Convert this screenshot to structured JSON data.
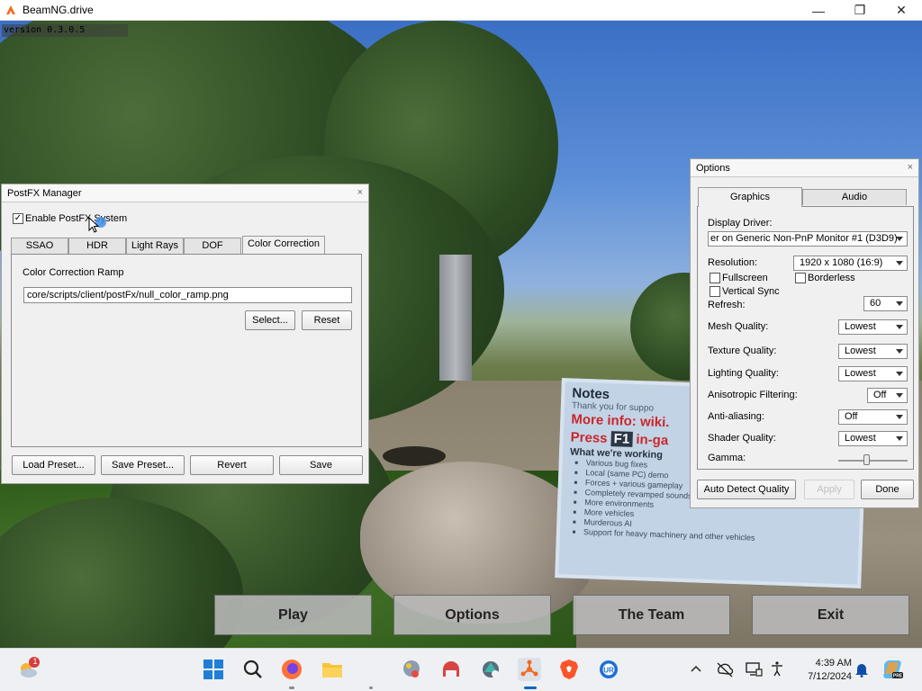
{
  "window": {
    "title": "BeamNG.drive",
    "version": "version 0.3.0.5",
    "controls": {
      "minimize": "—",
      "maximize": "❐",
      "close": "✕"
    }
  },
  "notes_sign": {
    "title": "Notes",
    "line1": "Thank you for suppo",
    "more_info": "More info: wiki.",
    "press": "Press",
    "key": "F1",
    "press_suffix": "in-ga",
    "working_on": "What we're working",
    "items": [
      "Various bug fixes",
      "Local (same PC) demo",
      "Forces + various gameplay",
      "Completely revamped sounds",
      "More environments",
      "More vehicles",
      "Murderous AI",
      "Support for heavy machinery and other vehicles"
    ]
  },
  "postfx": {
    "title": "PostFX Manager",
    "close": "×",
    "enable_label": "Enable PostFX System",
    "enable_checked": "✓",
    "tabs": [
      "SSAO",
      "HDR",
      "Light Rays",
      "DOF",
      "Color Correction"
    ],
    "active_tab": "Color Correction",
    "ramp_label": "Color Correction Ramp",
    "ramp_value": "core/scripts/client/postFx/null_color_ramp.png",
    "select_btn": "Select...",
    "reset_btn": "Reset",
    "load_preset": "Load Preset...",
    "save_preset": "Save Preset...",
    "revert": "Revert",
    "save": "Save"
  },
  "options": {
    "title": "Options",
    "close": "×",
    "tabs": [
      "Graphics",
      "Audio"
    ],
    "active_tab": "Graphics",
    "display_driver_label": "Display Driver:",
    "display_driver_value": "er on Generic Non-PnP Monitor #1 (D3D9)",
    "resolution_label": "Resolution:",
    "resolution_value": "1920 x 1080  (16:9)",
    "fullscreen_label": "Fullscreen",
    "borderless_label": "Borderless",
    "vsync_label": "Vertical Sync",
    "refresh_label": "Refresh:",
    "refresh_value": "60",
    "mesh_label": "Mesh Quality:",
    "mesh_value": "Lowest",
    "texture_label": "Texture Quality:",
    "texture_value": "Lowest",
    "lighting_label": "Lighting Quality:",
    "lighting_value": "Lowest",
    "aniso_label": "Anisotropic Filtering:",
    "aniso_value": "Off",
    "aa_label": "Anti-aliasing:",
    "aa_value": "Off",
    "shader_label": "Shader Quality:",
    "shader_value": "Lowest",
    "gamma_label": "Gamma:",
    "gamma_level": 0.4,
    "auto_detect": "Auto Detect Quality",
    "apply": "Apply",
    "done": "Done"
  },
  "main_menu": {
    "play": "Play",
    "options": "Options",
    "team": "The Team",
    "exit": "Exit"
  },
  "taskbar": {
    "weather_badge": "1",
    "time": "4:39 AM",
    "date": "7/12/2024",
    "icons": [
      "weather-icon",
      "windows-start-icon",
      "search-icon",
      "firefox-icon",
      "file-explorer-icon",
      "app-icon-1",
      "app-icon-2",
      "app-icon-3",
      "beamng-icon",
      "brave-icon",
      "app-icon-ur",
      "chevron-up-icon",
      "network-off-icon",
      "display-icon",
      "accessibility-icon",
      "notification-bell-icon",
      "copilot-icon"
    ],
    "colors": {
      "accent": "#0067c0",
      "beamng_orange": "#f26b21",
      "brave_orange": "#fb542b"
    }
  }
}
